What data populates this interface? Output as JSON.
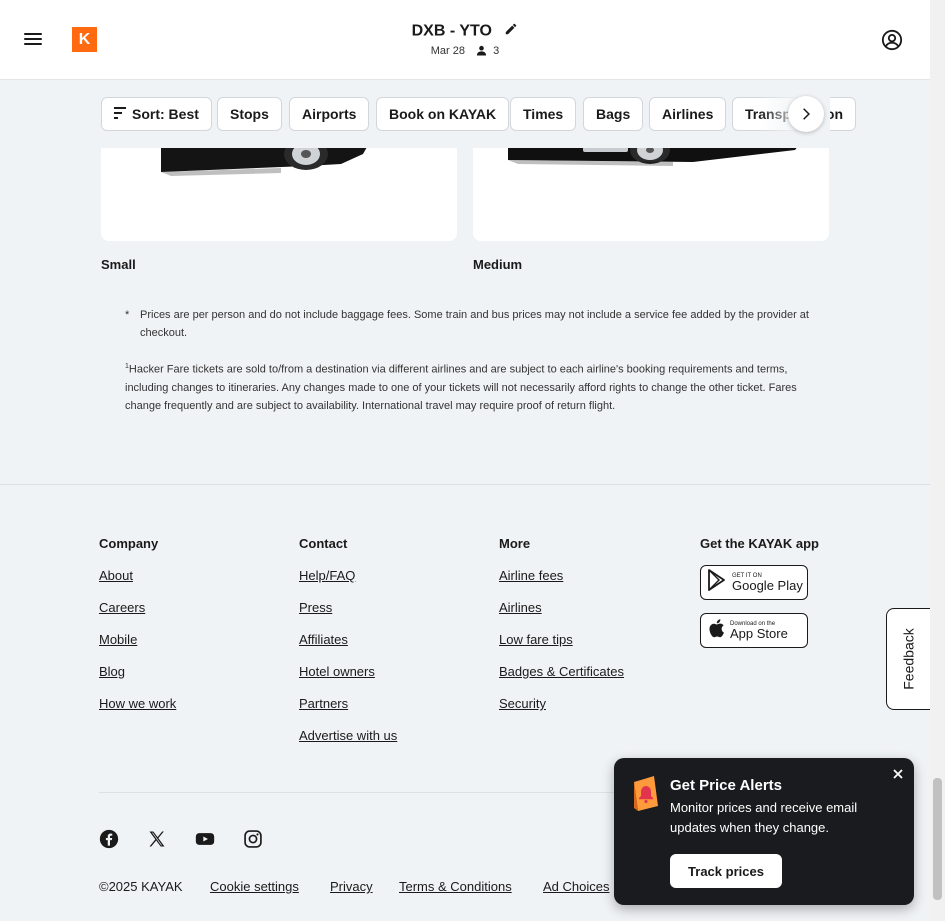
{
  "header": {
    "logo_letter": "K",
    "route": "DXB - YTO",
    "date": "Mar 28",
    "travelers": "3"
  },
  "filters": {
    "chips": [
      "Sort: Best",
      "Stops",
      "Airports",
      "Book on KAYAK",
      "Times",
      "Bags",
      "Airlines",
      "Transportation"
    ]
  },
  "cars": {
    "small_label": "Small",
    "medium_label": "Medium"
  },
  "notes": {
    "asterisk": "*",
    "prices": "Prices are per person and do not include baggage fees. Some train and bus prices may not include a service fee added by the provider at checkout.",
    "hacker_sup": "1",
    "hacker": "Hacker Fare tickets are sold to/from a destination via different airlines and are subject to each airline's booking requirements and terms, including changes to itineraries. Any changes made to one of your tickets will not necessarily afford rights to change the other ticket. Fares change frequently and are subject to availability. International travel may require proof of return flight."
  },
  "footer": {
    "company": {
      "heading": "Company",
      "links": [
        "About",
        "Careers",
        "Mobile",
        "Blog",
        "How we work"
      ]
    },
    "contact": {
      "heading": "Contact",
      "links": [
        "Help/FAQ",
        "Press",
        "Affiliates",
        "Hotel owners",
        "Partners",
        "Advertise with us"
      ]
    },
    "more": {
      "heading": "More",
      "links": [
        "Airline fees",
        "Airlines",
        "Low fare tips",
        "Badges & Certificates",
        "Security"
      ]
    },
    "app": {
      "heading": "Get the KAYAK app",
      "google_small": "GET IT ON",
      "google_big": "Google Play",
      "apple_small": "Download on the",
      "apple_big": "App Store"
    },
    "feedback": "Feedback",
    "copyright": "©2025 KAYAK",
    "bottom_links": [
      "Cookie settings",
      "Privacy",
      "Terms & Conditions",
      "Ad Choices"
    ]
  },
  "price_alert": {
    "title": "Get Price Alerts",
    "description": "Monitor prices and receive email updates when they change.",
    "button": "Track prices"
  },
  "colors": {
    "brand": "#ff690f",
    "background": "#f0f3f5",
    "alert_bg": "#1a1b1e"
  }
}
